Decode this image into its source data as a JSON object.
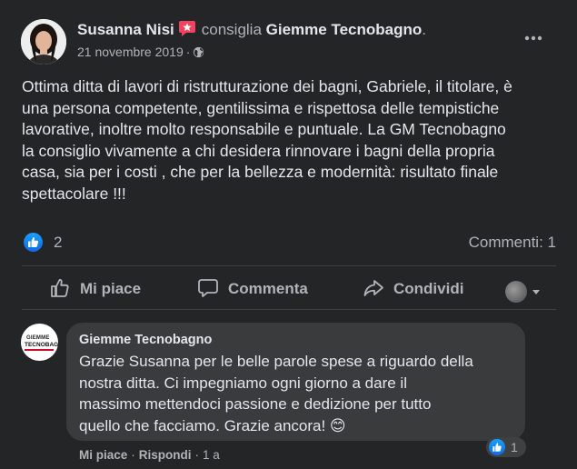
{
  "post": {
    "author": "Susanna Nisi",
    "verb": "consiglia",
    "page_name": "Giemme Tecnobagno",
    "page_suffix": ".",
    "date": "21 novembre 2019",
    "meta_separator": "·",
    "audience_icon": "globe-icon",
    "body": "Ottima ditta di lavori di ristrutturazione dei bagni, Gabriele, il titolare, è\nuna persona competente, gentilissima e rispettosa delle tempistiche\nlavorative, inoltre molto responsabile e puntuale. La GM Tecnobagno\nla consiglio vivamente a chi desidera rinnovare i bagni della propria\ncasa,  sia per i costi , che per la bellezza e modernità:  risultato finale\nspettacolare !!!",
    "reactions": {
      "like_count": "2",
      "comments_label": "Commenti: 1"
    },
    "actions": {
      "like": "Mi piace",
      "comment": "Commenta",
      "share": "Condividi"
    }
  },
  "comment": {
    "author": "Giemme Tecnobagno",
    "avatar_logo_top": "GIEMME",
    "avatar_logo_bottom": "TECNOBAGNO",
    "text": "Grazie Susanna per le belle parole spese a riguardo della\nnostra ditta. Ci impegniamo ogni giorno a dare il\nmassimo mettendoci passione e dedizione per tutto\nquello che facciamo. Grazie ancora! 😊",
    "reaction_count": "1",
    "actions": {
      "like": "Mi piace",
      "sep": "·",
      "reply": "Rispondi",
      "time": "1 a"
    }
  },
  "colors": {
    "background": "#242526",
    "bubble": "#3a3b3c",
    "text_primary": "#e4e6eb",
    "text_secondary": "#b0b3b8",
    "like_blue": "#1877f2",
    "recommend_badge": "#f3425f"
  }
}
